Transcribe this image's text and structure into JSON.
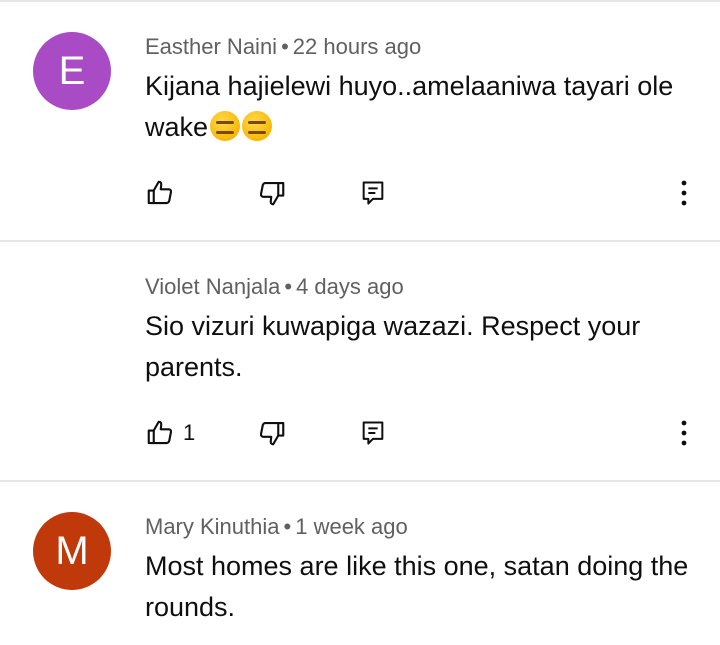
{
  "comments": [
    {
      "author": "Easther Naini",
      "separator": "•",
      "time": "22 hours ago",
      "avatar_letter": "E",
      "avatar_color": "#a94bc4",
      "text": "Kijana hajielewi huyo..amelaaniwa tayari ole wake",
      "emojis": [
        "expressionless-face-icon",
        "expressionless-face-icon"
      ],
      "like_count": ""
    },
    {
      "author": "Violet Nanjala",
      "separator": "•",
      "time": "4 days ago",
      "avatar_letter": "",
      "avatar_color": "",
      "text": "Sio vizuri kuwapiga wazazi. Respect your parents.",
      "emojis": [],
      "like_count": "1"
    },
    {
      "author": "Mary Kinuthia",
      "separator": "•",
      "time": "1 week ago",
      "avatar_letter": "M",
      "avatar_color": "#c0390b",
      "text": "Most homes are like this one, satan doing the rounds.",
      "emojis": [],
      "like_count": ""
    }
  ],
  "icons": {
    "like": "thumbs-up-icon",
    "dislike": "thumbs-down-icon",
    "reply": "reply-icon",
    "more": "more-vertical-icon"
  }
}
